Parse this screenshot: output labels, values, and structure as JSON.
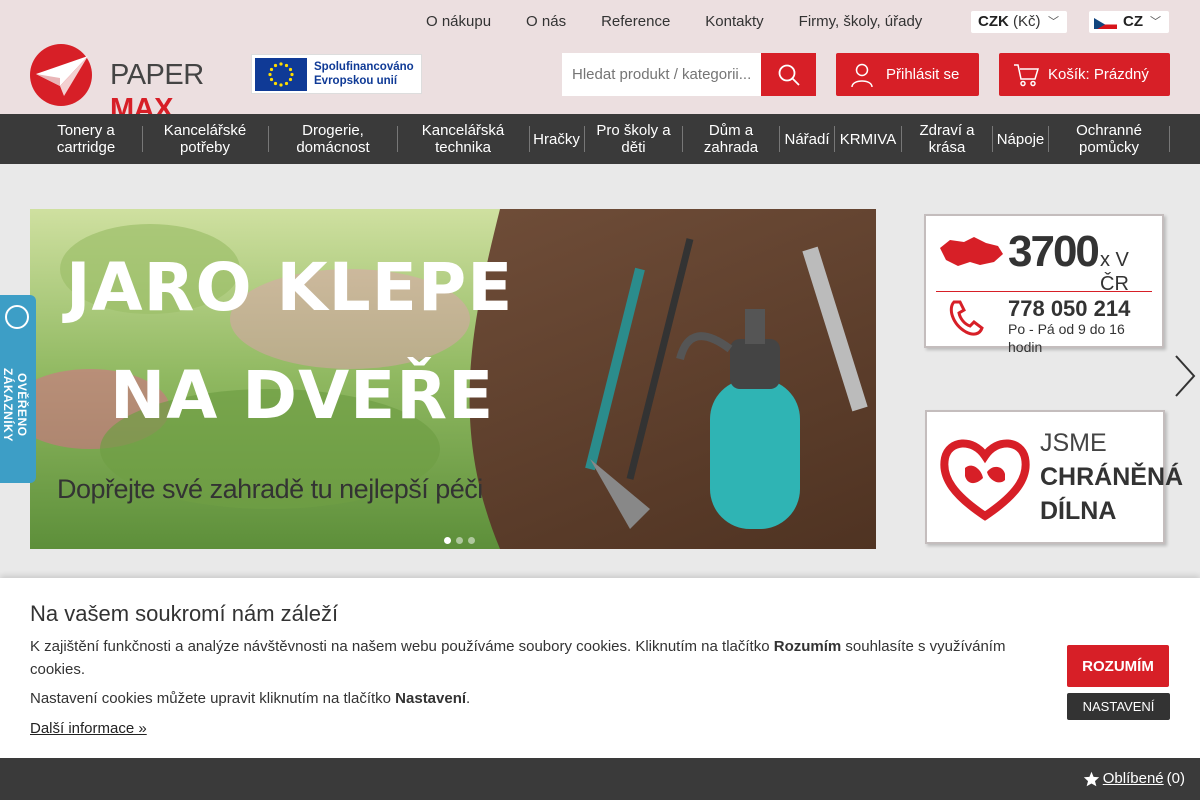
{
  "topnav": [
    "O nákupu",
    "O nás",
    "Reference",
    "Kontakty",
    "Firmy, školy, úřady"
  ],
  "currency": {
    "code": "CZK",
    "symbol": "(Kč)"
  },
  "language": "CZ",
  "logo": {
    "part1": "PAPER",
    "part2": "MAX"
  },
  "eu": {
    "line1": "Spolufinancováno",
    "line2": "Evropskou unií"
  },
  "search": {
    "placeholder": "Hledat produkt / kategorii..."
  },
  "login_label": "Přihlásit se",
  "cart_label": "Košík: Prázdný",
  "categories": [
    "Tonery a cartridge",
    "Kancelářské potřeby",
    "Drogerie, domácnost",
    "Kancelářská technika",
    "Hračky",
    "Pro školy a děti",
    "Dům a zahrada",
    "Nářadí",
    "KRMIVA",
    "Zdraví a krása",
    "Nápoje",
    "Ochranné pomůcky"
  ],
  "banner": {
    "title_line1": "JARO KLEPE",
    "title_line2": "NA DVEŘE",
    "subtitle": "Dopřejte své zahradě tu nejlepší péči",
    "slide_count": 3,
    "active_slide": 1
  },
  "ad_stores": {
    "count": "3700",
    "suffix": "x V ČR",
    "phone": "778 050 214",
    "hours": "Po - Pá od 9 do 16 hodin"
  },
  "ad_workshop": {
    "line1": "JSME",
    "line2": "CHRÁNĚNÁ",
    "line3": "DÍLNA"
  },
  "badge_text": "OVĚŘENO ZÁKAZNÍKY",
  "cookie": {
    "title": "Na vašem soukromí nám záleží",
    "text1_a": "K zajištění funkčnosti a analýze návštěvnosti na našem webu používáme soubory cookies. Kliknutím na tlačítko ",
    "text1_b": "Rozumím",
    "text1_c": " souhlasíte s využíváním cookies.",
    "text2_a": "Nastavení cookies můžete upravit kliknutím na tlačítko ",
    "text2_b": "Nastavení",
    "text2_c": ".",
    "more": "Další informace »",
    "accept": "ROZUMÍM",
    "settings": "NASTAVENÍ"
  },
  "favorites": {
    "label": "Oblíbené",
    "count": "(0)"
  },
  "colors": {
    "accent": "#d71f27",
    "header_bg": "#ecdfe0",
    "nav_bg": "#3a3a3a",
    "badge": "#3d9ec6"
  }
}
